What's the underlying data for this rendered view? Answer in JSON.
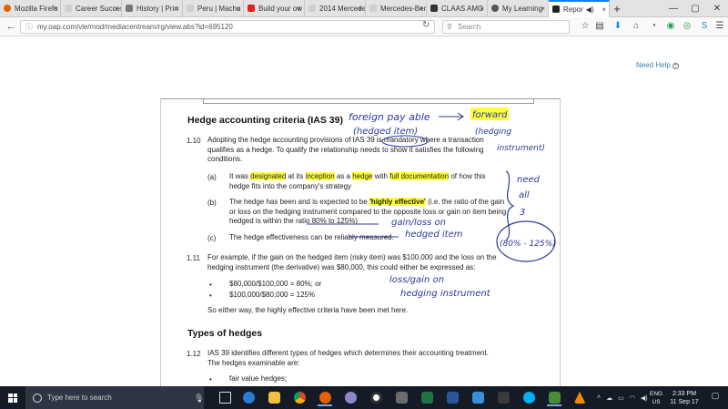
{
  "browser": {
    "tabs": [
      {
        "label": "Mozilla Firefo",
        "color": "#e66000"
      },
      {
        "label": "Career Success C",
        "color": "#cfcfcf"
      },
      {
        "label": "History | Prin",
        "color": "#777777"
      },
      {
        "label": "Peru | Machu",
        "color": "#cfcfcf"
      },
      {
        "label": "Build your ow",
        "color": "#e62117"
      },
      {
        "label": "2014 Mercede",
        "color": "#cfcfcf"
      },
      {
        "label": "Mercedes-Benz p",
        "color": "#cfcfcf"
      },
      {
        "label": "CLAAS AMG",
        "color": "#333333"
      },
      {
        "label": "My Learning",
        "color": "#555555"
      },
      {
        "label": "Repor",
        "color": "#222222"
      }
    ],
    "url": "my.oap.com/vle/mod/mediacentream/rg/view.abs?id=695120",
    "search_placeholder": "Search"
  },
  "page": {
    "need_help": "Need Help",
    "help_icon": "?"
  },
  "document": {
    "heading1": "Hedge accounting criteria (IAS 39)",
    "p110_num": "1.10",
    "p110_text": "Adopting the hedge accounting provisions of IAS 39 is mandatory where a transaction qualifies as a hedge. To qualify the relationship needs to show it satisfies the following conditions.",
    "item_a_label": "(a)",
    "item_a": {
      "t1": "It was ",
      "h1": "designated",
      "t2": " at its ",
      "h2": "inception",
      "t3": " as a ",
      "h3": "hedge",
      "t4": " with ",
      "h4": "full documentation",
      "t5": " of how this hedge fits into the company's strategy"
    },
    "item_b_label": "(b)",
    "item_b": {
      "t1": "The hedge has been and is expected to be ",
      "h1": "'highly effective'",
      "t2": " (i.e. the ratio of the gain or loss on the hedging instrument compared to the opposite loss or gain on item being hedged is within the ratio 80% to 125%)"
    },
    "item_c_label": "(c)",
    "item_c": "The hedge effectiveness can be reliably measured.",
    "p111_num": "1.11",
    "p111_text": "For example, if the gain on the hedged item (risky item) was $100,000 and the loss on the hedging instrument (the derivative) was $80,000, this could either be expressed as:",
    "bullet1": "$80,000/$100,000 = 80%; or",
    "bullet2": "$100,000/$80,000 = 125%",
    "so_either": "So either way, the highly effective criteria have been met here.",
    "heading2": "Types of hedges",
    "p112_num": "1.12",
    "p112_text": "IAS 39 identifies different types of hedges which determines their accounting treatment. The hedges examinable are:",
    "bullet3": "fair value hedges;"
  },
  "handwriting": {
    "n1": "foreign pay able",
    "n2": "(hedged item)",
    "n3": "forward",
    "n4": "(hedging",
    "n5": "instrument)",
    "n6": "need",
    "n7": "all",
    "n8": "3",
    "n9": "gain/loss on",
    "n10": "hedged item",
    "n11": "(80% - 125%)",
    "n12": "loss/gain on",
    "n13": "hedging instrument"
  },
  "taskbar": {
    "search_placeholder": "Type here to search",
    "lang_top": "ENG",
    "lang_bottom": "US",
    "time": "2:33 PM",
    "date": "11 Sep 17"
  }
}
